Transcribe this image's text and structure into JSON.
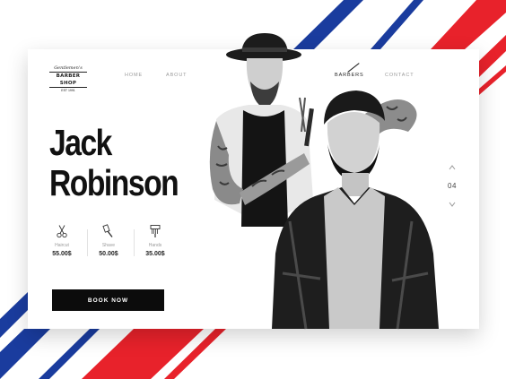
{
  "brand": {
    "logo_top": "Gentlemen's",
    "logo_main": "BARBER SHOP",
    "logo_sub": "EST 1991"
  },
  "nav": {
    "items": [
      {
        "label": "HOME"
      },
      {
        "label": "ABOUT"
      },
      {
        "label": "BARBERS",
        "active": true
      },
      {
        "label": "CONTACT"
      }
    ]
  },
  "hero": {
    "first_name": "Jack",
    "last_name": "Robinson"
  },
  "services": [
    {
      "name": "Haircut",
      "price": "55.00$",
      "icon": "scissors-icon"
    },
    {
      "name": "Shave",
      "price": "50.00$",
      "icon": "razor-icon"
    },
    {
      "name": "Hands",
      "price": "35.00$",
      "icon": "comb-icon"
    }
  ],
  "cta": {
    "label": "BOOK NOW"
  },
  "pager": {
    "current": "04"
  },
  "colors": {
    "stripe_red": "#e8222b",
    "stripe_blue": "#1a3c9e",
    "button": "#0c0c0c",
    "text": "#111111"
  }
}
